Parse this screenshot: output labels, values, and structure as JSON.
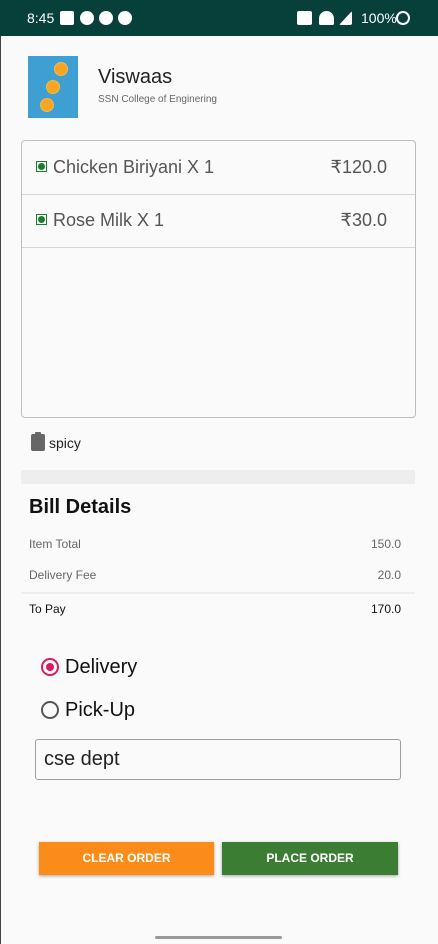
{
  "status_bar": {
    "time": "8:45",
    "battery": "100%",
    "left_icons": [
      "gmail-icon",
      "message-icon",
      "whatsapp-icon",
      "record-icon"
    ],
    "right_icons": [
      "cast-icon",
      "wifi-icon",
      "signal-icon",
      "battery-icon"
    ]
  },
  "store": {
    "name": "Viswaas",
    "location": "SSN College of Enginering"
  },
  "cart": {
    "items": [
      {
        "name": "Chicken Biriyani X 1",
        "price": "₹120.0"
      },
      {
        "name": "Rose Milk X 1",
        "price": "₹30.0"
      }
    ]
  },
  "note": {
    "text": "spicy"
  },
  "bill": {
    "title": "Bill Details",
    "item_total_label": "Item Total",
    "item_total_value": "150.0",
    "delivery_fee_label": "Delivery Fee",
    "delivery_fee_value": "20.0",
    "to_pay_label": "To Pay",
    "to_pay_value": "170.0"
  },
  "mode": {
    "options": [
      {
        "label": "Delivery",
        "selected": true
      },
      {
        "label": "Pick-Up",
        "selected": false
      }
    ]
  },
  "address": {
    "value": "cse dept"
  },
  "actions": {
    "clear_label": "CLEAR ORDER",
    "place_label": "PLACE ORDER"
  },
  "colors": {
    "status_bar": "#07403a",
    "clear_button": "#fb8c1a",
    "place_button": "#3b7d33",
    "radio_accent": "#d81b60",
    "veg_mark": "#1b7d2e"
  }
}
